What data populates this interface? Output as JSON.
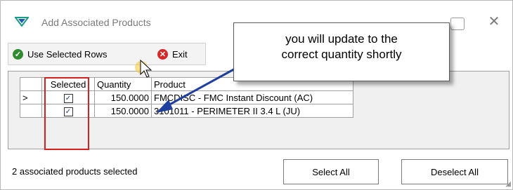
{
  "window": {
    "title": "Add Associated Products",
    "close_symbol": "✕"
  },
  "toolbar": {
    "use_selected_label": "Use Selected Rows",
    "exit_label": "Exit"
  },
  "grid": {
    "columns": [
      "Selected",
      "Quantity",
      "Product"
    ],
    "rows": [
      {
        "indicator": ">",
        "selected": true,
        "quantity": "150.0000",
        "product": "FMCDISC - FMC Instant Discount (AC)"
      },
      {
        "indicator": "",
        "selected": true,
        "quantity": "150.0000",
        "product": "3101011 - PERIMETER II 3.4 L (JU)"
      }
    ]
  },
  "status_text": "2 associated products selected",
  "buttons": {
    "select_all": "Select All",
    "deselect_all": "Deselect All"
  },
  "callout": {
    "line1": "you will update to the",
    "line2": "correct quantity shortly"
  },
  "colors": {
    "callout_arrow": "#1f3f9f",
    "highlight_box": "#d42020",
    "use_selected_icon": "#2e8b2e",
    "exit_icon": "#d62828",
    "app_icon": "#1a9b8a"
  },
  "icons": {
    "app": "logo-icon",
    "use_selected": "checkmark-icon",
    "exit": "exit-icon",
    "cursor": "mouse-pointer-icon"
  }
}
